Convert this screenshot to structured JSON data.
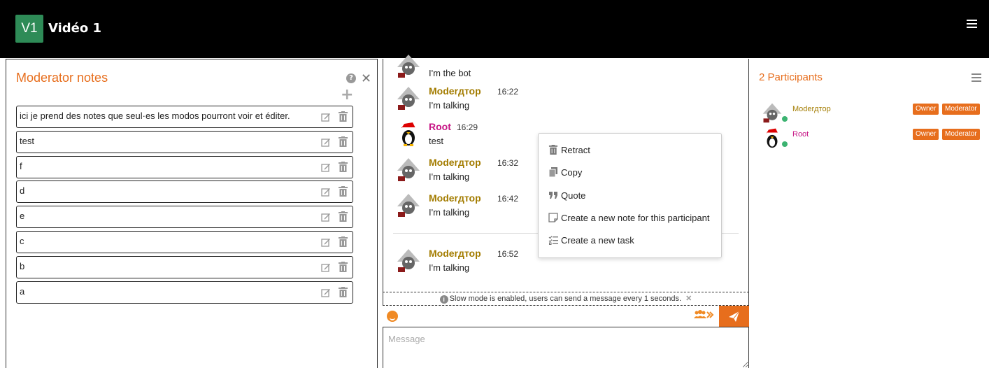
{
  "header": {
    "logo_text": "V1",
    "room_title": "Vidéo 1",
    "menu_icon": "hamburger-icon"
  },
  "notes": {
    "title": "Moderator notes",
    "help_icon": "question-circle-icon",
    "close_icon": "close-icon",
    "add_icon": "plus-icon",
    "items": [
      {
        "text": "ici je prend des notes que seul·es les modos pourront voir et éditer."
      },
      {
        "text": "test"
      },
      {
        "text": "f"
      },
      {
        "text": "d"
      },
      {
        "text": "e"
      },
      {
        "text": "c"
      },
      {
        "text": "b"
      },
      {
        "text": "a"
      }
    ]
  },
  "chat": {
    "messages": [
      {
        "author": "",
        "time": "",
        "body": "I'm the bot",
        "kind": "mod"
      },
      {
        "author": "Moderдтор",
        "time": "16:22",
        "body": "I'm talking",
        "kind": "mod"
      },
      {
        "author": "Root",
        "time": "16:29",
        "body": "test",
        "kind": "root"
      },
      {
        "author": "Moderдтор",
        "time": "16:32",
        "body": "I'm talking",
        "kind": "mod"
      },
      {
        "author": "Moderдтор",
        "time": "16:42",
        "body": "I'm talking",
        "kind": "mod"
      },
      {
        "author": "Moderдтор",
        "time": "16:52",
        "body": "I'm talking",
        "kind": "mod"
      }
    ],
    "context_menu": [
      {
        "label": "Retract",
        "icon": "trash-icon"
      },
      {
        "label": "Copy",
        "icon": "copy-icon"
      },
      {
        "label": "Quote",
        "icon": "quote-icon"
      },
      {
        "label": "Create a new note for this participant",
        "icon": "note-icon"
      },
      {
        "label": "Create a new task",
        "icon": "task-list-icon"
      }
    ],
    "slow_mode": "Slow mode is enabled, users can send a message every 1 seconds.",
    "input_placeholder": "Message"
  },
  "participants": {
    "title": "2 Participants",
    "items": [
      {
        "name": "Moderдтор",
        "badges": [
          "Owner",
          "Moderator"
        ],
        "status": "online"
      },
      {
        "name": "Root",
        "badges": [
          "Owner",
          "Moderator"
        ],
        "status": "online"
      }
    ]
  },
  "colors": {
    "accent": "#e76e1d",
    "logo_bg": "#2e8b57",
    "moderator_name": "#a37c00",
    "root_name": "#c71585",
    "online": "#3cb371"
  }
}
